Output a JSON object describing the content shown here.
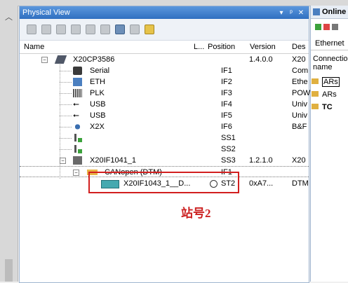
{
  "panel": {
    "title": "Physical View",
    "pin_label": "▾",
    "dock_label": "ᵖ",
    "close_label": "✕"
  },
  "columns": {
    "name": "Name",
    "l": "L...",
    "position": "Position",
    "version": "Version",
    "description": "Des"
  },
  "tree": [
    {
      "name": "X20CP3586",
      "position": "",
      "version": "1.4.0.0",
      "desc": "X20"
    },
    {
      "name": "Serial",
      "position": "IF1",
      "version": "",
      "desc": "Com"
    },
    {
      "name": "ETH",
      "position": "IF2",
      "version": "",
      "desc": "Ethe"
    },
    {
      "name": "PLK",
      "position": "IF3",
      "version": "",
      "desc": "POW"
    },
    {
      "name": "USB",
      "position": "IF4",
      "version": "",
      "desc": "Univ"
    },
    {
      "name": "USB",
      "position": "IF5",
      "version": "",
      "desc": "Univ"
    },
    {
      "name": "X2X",
      "position": "IF6",
      "version": "",
      "desc": "B&F"
    },
    {
      "name": "",
      "position": "SS1",
      "version": "",
      "desc": ""
    },
    {
      "name": "",
      "position": "SS2",
      "version": "",
      "desc": ""
    },
    {
      "name": "X20IF1041_1",
      "position": "SS3",
      "version": "1.2.1.0",
      "desc": "X20"
    },
    {
      "name": "CANopen (DTM)",
      "position": "IF1",
      "version": "",
      "desc": ""
    },
    {
      "name": "X20IF1043_1__D...",
      "position": "ST2",
      "version": "0xA7...",
      "desc": "DTM"
    }
  ],
  "annotation": "站号2",
  "right": {
    "title": "Online",
    "tab": "Ethernet",
    "connection_label": "Connection name",
    "items": [
      "ARs",
      "ARs",
      "TC"
    ]
  }
}
